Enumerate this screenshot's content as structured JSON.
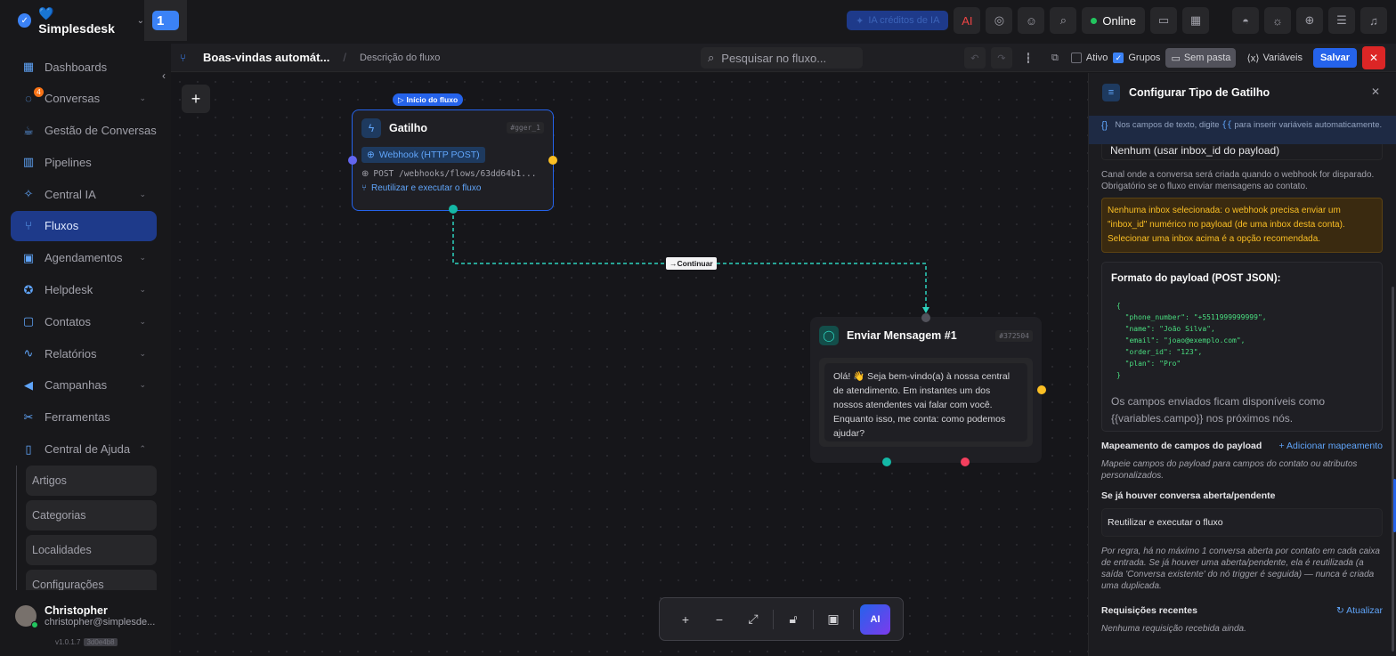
{
  "topbar": {
    "brand_name": "💙Simplesdesk",
    "workspace_number": "1",
    "credits_label": "IA créditos de IA",
    "online_label": "Online"
  },
  "sidebar": {
    "items": [
      {
        "label": "Dashboards",
        "icon": "dashboard-icon",
        "chevron": false
      },
      {
        "label": "Conversas",
        "icon": "chat-icon",
        "chevron": true,
        "badge": "4"
      },
      {
        "label": "Gestão de Conversas",
        "icon": "coffee-icon",
        "chevron": false
      },
      {
        "label": "Pipelines",
        "icon": "kanban-icon",
        "chevron": false
      },
      {
        "label": "Central IA",
        "icon": "ai-icon",
        "chevron": true
      },
      {
        "label": "Fluxos",
        "icon": "flow-icon",
        "chevron": false,
        "active": true
      },
      {
        "label": "Agendamentos",
        "icon": "calendar-icon",
        "chevron": true
      },
      {
        "label": "Helpdesk",
        "icon": "helpdesk-icon",
        "chevron": true
      },
      {
        "label": "Contatos",
        "icon": "contacts-icon",
        "chevron": true
      },
      {
        "label": "Relatórios",
        "icon": "chart-icon",
        "chevron": true
      },
      {
        "label": "Campanhas",
        "icon": "megaphone-icon",
        "chevron": true
      },
      {
        "label": "Ferramentas",
        "icon": "tools-icon",
        "chevron": false
      },
      {
        "label": "Central de Ajuda",
        "icon": "book-icon",
        "chevron": true
      }
    ],
    "sub_items": [
      "Artigos",
      "Categorias",
      "Localidades",
      "Configurações"
    ],
    "user_name": "Christopher",
    "user_email": "christopher@simplesde...",
    "version": "v1.0.1.7",
    "version_hash": "3d0e4b8"
  },
  "flowbar": {
    "title": "Boas-vindas automát...",
    "separator": "/",
    "description": "Descrição do fluxo",
    "search_placeholder": "Pesquisar no fluxo...",
    "ativo_label": "Ativo",
    "grupos_label": "Grupos",
    "pasta_label": "Sem pasta",
    "vars_label": "Variáveis",
    "save_label": "Salvar"
  },
  "canvas": {
    "start_badge": "Início do fluxo",
    "edge_label": "Continuar",
    "trigger": {
      "title": "Gatilho",
      "id": "#gger_1",
      "webhook": "Webhook (HTTP POST)",
      "endpoint": "POST /webhooks/flows/63dd64b1...",
      "reuse": "Reutilizar e executar o fluxo"
    },
    "message": {
      "title": "Enviar Mensagem #1",
      "id": "#372504",
      "text": "Olá! 👋 Seja bem-vindo(a) à nossa central de atendimento. Em instantes um dos nossos atendentes vai falar com você. Enquanto isso, me conta: como podemos ajudar?"
    },
    "colors": {
      "accent": "#2563eb",
      "handle_purple": "#6366f1",
      "handle_orange": "#fbbf24",
      "handle_green": "#14b8a6",
      "handle_red": "#f43f5e",
      "edge": "#2dd4bf"
    }
  },
  "panel": {
    "title": "Configurar Tipo de Gatilho",
    "hint_prefix": "Nos campos de texto, digite",
    "hint_code": "{{",
    "hint_suffix": "para inserir variáveis automaticamente.",
    "inbox_select_value": "Nenhum (usar inbox_id do payload)",
    "inbox_help": "Canal onde a conversa será criada quando o webhook for disparado. Obrigatório se o fluxo enviar mensagens ao contato.",
    "warning": "Nenhuma inbox selecionada: o webhook precisa enviar um \"inbox_id\" numérico no payload (de uma inbox desta conta). Selecionar uma inbox acima é a opção recomendada.",
    "payload_title": "Formato do payload (POST JSON):",
    "payload_code": "{\n  \"phone_number\": \"+5511999999999\",\n  \"name\": \"João Silva\",\n  \"email\": \"joao@exemplo.com\",\n  \"order_id\": \"123\",\n  \"plan\": \"Pro\"\n}",
    "payload_note": "Os campos enviados ficam disponíveis como {{variables.campo}} nos próximos nós.",
    "mapping_title": "Mapeamento de campos do payload",
    "mapping_add": "+ Adicionar mapeamento",
    "mapping_help": "Mapeie campos do payload para campos do contato ou atributos personalizados.",
    "open_conv_title": "Se já houver conversa aberta/pendente",
    "open_conv_value": "Reutilizar e executar o fluxo",
    "open_conv_help": "Por regra, há no máximo 1 conversa aberta por contato em cada caixa de entrada. Se já houver uma aberta/pendente, ela é reutilizada (a saída 'Conversa existente' do nó trigger é seguida) — nunca é criada uma duplicada.",
    "recent_title": "Requisições recentes",
    "recent_refresh": "Atualizar",
    "recent_empty": "Nenhuma requisição recebida ainda."
  }
}
